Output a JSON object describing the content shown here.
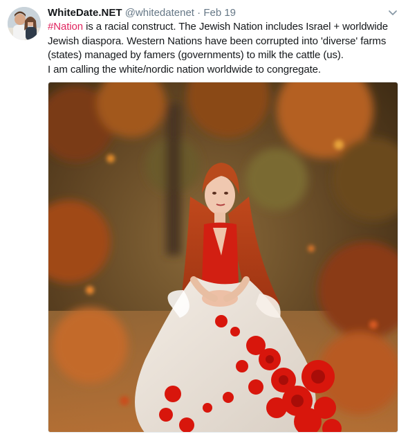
{
  "tweet": {
    "display_name": "WhiteDate.NET",
    "handle": "@whitedatenet",
    "separator": "·",
    "date": "Feb 19",
    "hashtag": "#Nation",
    "text_line1_rest": " is a racial construct. The Jewish Nation includes Israel + worldwide",
    "text_line2": "Jewish diaspora. Western Nations have been corrupted into 'diverse' farms",
    "text_line3": "(states) managed by famers (governments) to milk the cattle (us).",
    "text_line4": "I am calling the white/nordic nation worldwide to congregate."
  },
  "icons": {
    "menu": "chevron-down-icon"
  },
  "colors": {
    "hashtag": "#e0245e",
    "name": "#14171a",
    "meta": "#657786"
  }
}
